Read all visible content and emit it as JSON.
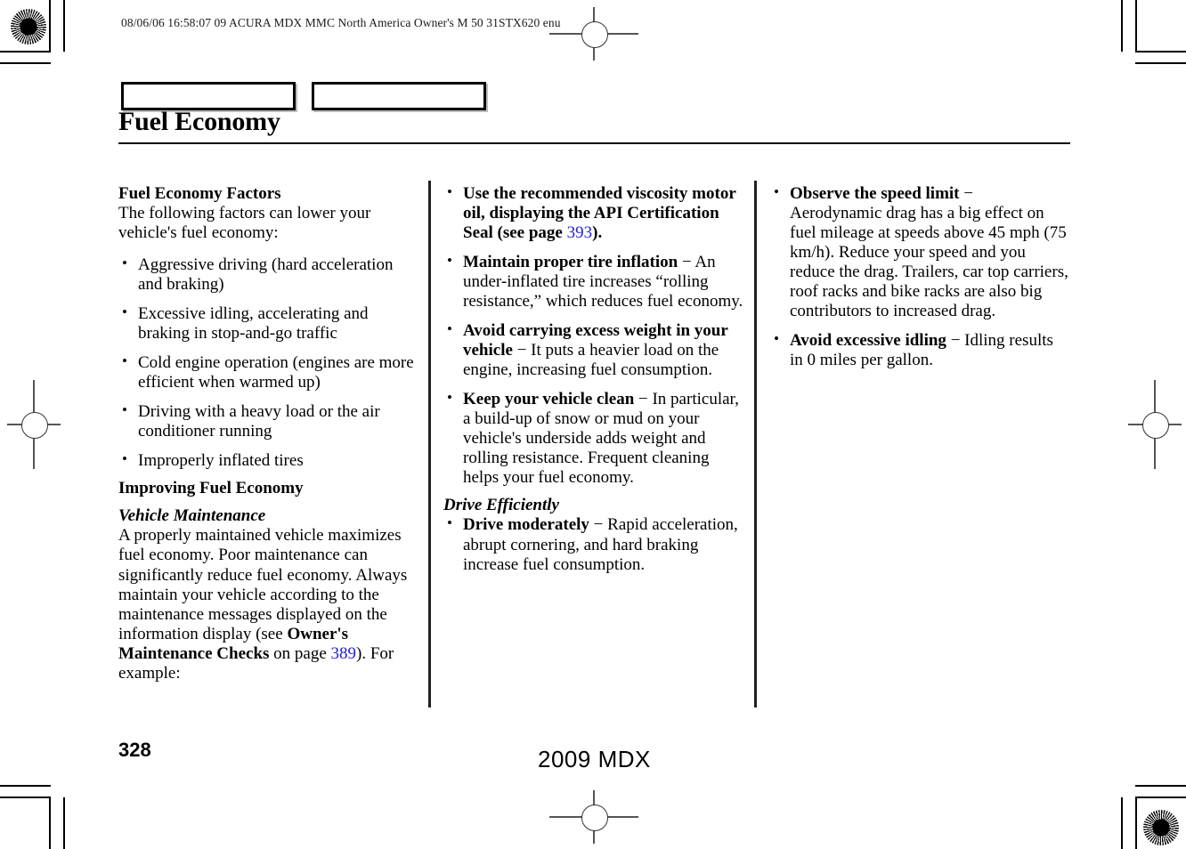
{
  "header": {
    "slug": "08/06/06 16:58:07    09 ACURA MDX MMC North America Owner's M 50 31STX620 enu"
  },
  "title": "Fuel Economy",
  "colors": {
    "page_reference_link": "#2222DD",
    "rule": "#000000",
    "column_divider": "#231F20"
  },
  "column1": {
    "heading": "Fuel Economy Factors",
    "intro": "The following factors can lower your vehicle's fuel economy:",
    "bullets": [
      "Aggressive driving (hard acceleration and braking)",
      "Excessive idling, accelerating and braking in stop-and-go traffic",
      "Cold engine operation (engines are more efficient when warmed up)",
      "Driving with a heavy load or the air conditioner running",
      "Improperly inflated tires"
    ],
    "heading2": "Improving Fuel Economy",
    "subheading": "Vehicle Maintenance",
    "paragraph_part1": "A properly maintained vehicle maximizes fuel economy. Poor maintenance can significantly reduce fuel economy. Always maintain your vehicle according to the maintenance messages displayed on the information display (see ",
    "paragraph_bold": "Owner's Maintenance Checks",
    "paragraph_part2": " on page ",
    "paragraph_page_ref": "389",
    "paragraph_part3": "). For example:"
  },
  "column2": {
    "bullets": [
      {
        "lead": "Use the recommended viscosity motor oil, displaying the API Certification Seal (see page ",
        "page_ref": "393",
        "lead_tail": ").",
        "dash": "",
        "body": ""
      },
      {
        "lead": "Maintain proper tire inflation",
        "dash": "−",
        "body": "An under-inflated tire increases “rolling resistance,” which reduces fuel economy."
      },
      {
        "lead": "Avoid carrying excess weight in your vehicle",
        "dash": "−",
        "body": "It puts a heavier load on the engine, increasing fuel consumption."
      },
      {
        "lead": "Keep your vehicle clean",
        "dash": "−",
        "body": "In particular, a build-up of snow or mud on your vehicle's underside adds weight and rolling resistance. Frequent cleaning helps your fuel economy."
      }
    ],
    "subheading": "Drive Efficiently",
    "bullets2": [
      {
        "lead": "Drive moderately",
        "dash": "−",
        "body": "Rapid acceleration, abrupt cornering, and hard braking increase fuel consumption."
      }
    ]
  },
  "column3": {
    "bullets": [
      {
        "lead": "Observe the speed limit",
        "dash": "−",
        "body": "Aerodynamic drag has a big effect on fuel mileage at speeds above 45 mph (75 km/h). Reduce your speed and you reduce the drag. Trailers, car top carriers, roof racks and bike racks are also big contributors to increased drag."
      },
      {
        "lead": "Avoid excessive idling",
        "dash": "−",
        "body": "Idling results in 0 miles per gallon."
      }
    ]
  },
  "footer": {
    "page_number": "328",
    "model": "2009  MDX"
  }
}
